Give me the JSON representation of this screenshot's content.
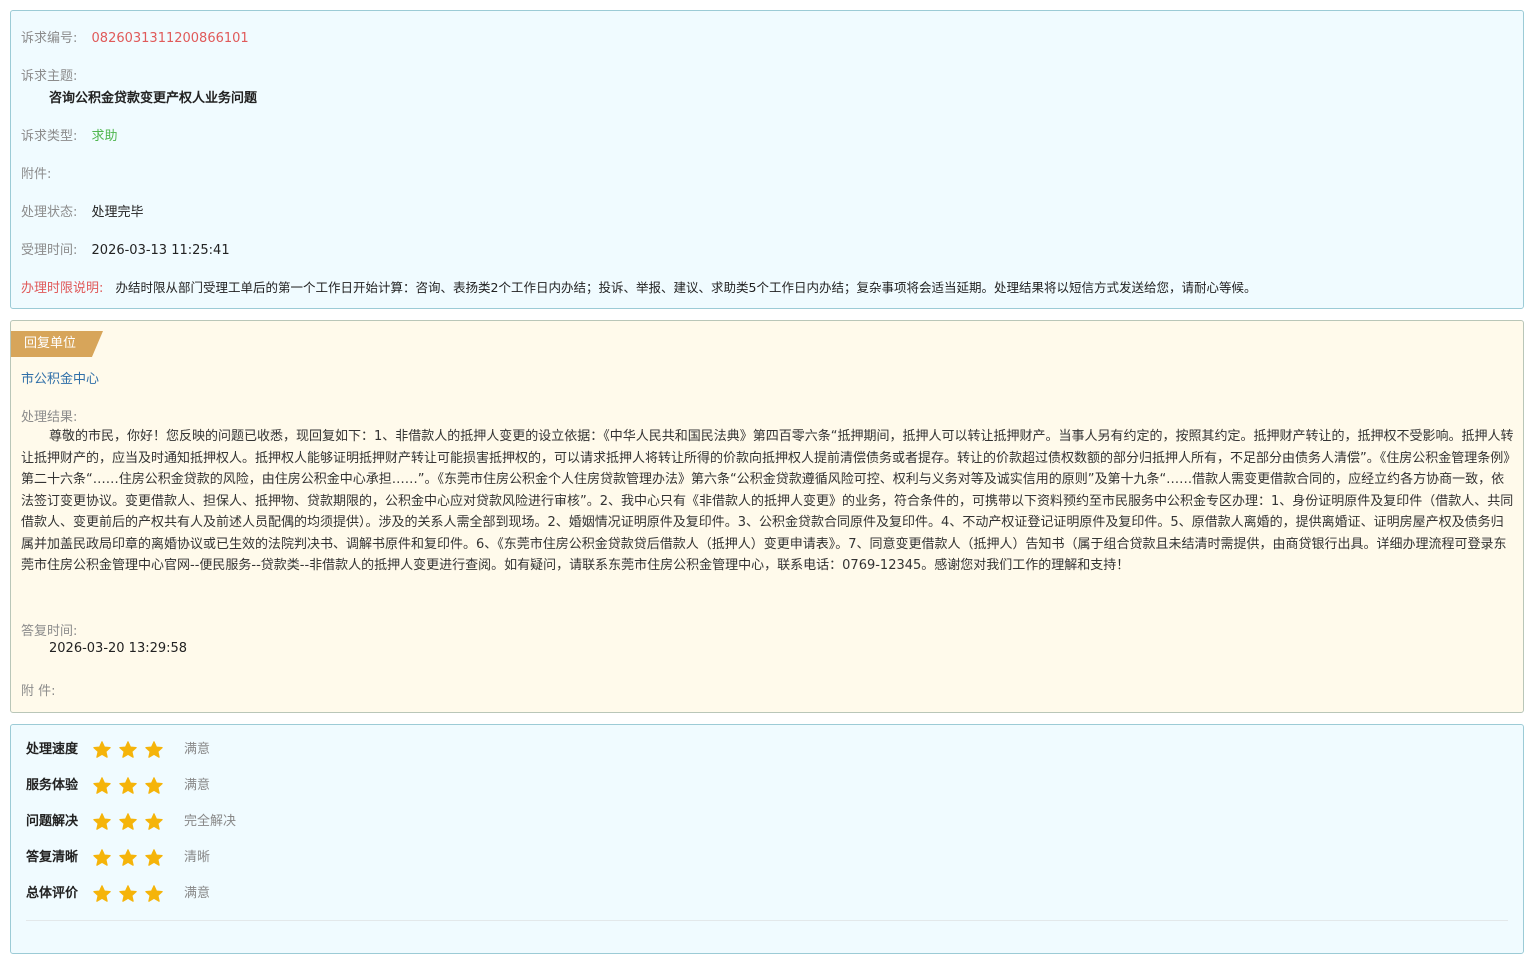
{
  "case": {
    "id_label": "诉求编号:",
    "id_value": "0826031311200866101",
    "subject_label": "诉求主题:",
    "subject_value": "咨询公积金贷款变更产权人业务问题",
    "type_label": "诉求类型:",
    "type_value": "求助",
    "attachment_label": "附件:",
    "status_label": "处理状态:",
    "status_value": "处理完毕",
    "time_label": "受理时间:",
    "time_value": "2026-03-13 11:25:41",
    "deadline_label": "办理时限说明:",
    "deadline_value": "办结时限从部门受理工单后的第一个工作日开始计算：咨询、表扬类2个工作日内办结；投诉、举报、建议、求助类5个工作日内办结；复杂事项将会适当延期。处理结果将以短信方式发送给您，请耐心等候。"
  },
  "reply": {
    "tag": "回复单位",
    "unit": "市公积金中心",
    "result_label": "处理结果:",
    "result_text": "尊敬的市民，你好！您反映的问题已收悉，现回复如下：1、非借款人的抵押人变更的设立依据：《中华人民共和国民法典》第四百零六条“抵押期间，抵押人可以转让抵押财产。当事人另有约定的，按照其约定。抵押财产转让的，抵押权不受影响。抵押人转让抵押财产的，应当及时通知抵押权人。抵押权人能够证明抵押财产转让可能损害抵押权的，可以请求抵押人将转让所得的价款向抵押权人提前清偿债务或者提存。转让的价款超过债权数额的部分归抵押人所有，不足部分由债务人清偿”。《住房公积金管理条例》第二十六条“……住房公积金贷款的风险，由住房公积金中心承担……”。《东莞市住房公积金个人住房贷款管理办法》第六条“公积金贷款遵循风险可控、权利与义务对等及诚实信用的原则”及第十九条“……借款人需变更借款合同的，应经立约各方协商一致，依法签订变更协议。变更借款人、担保人、抵押物、贷款期限的，公积金中心应对贷款风险进行审核”。2、我中心只有《非借款人的抵押人变更》的业务，符合条件的，可携带以下资料预约至市民服务中公积金专区办理：1、身份证明原件及复印件（借款人、共同借款人、变更前后的产权共有人及前述人员配偶的均须提供）。涉及的关系人需全部到现场。2、婚姻情况证明原件及复印件。3、公积金贷款合同原件及复印件。4、不动产权证登记证明原件及复印件。5、原借款人离婚的，提供离婚证、证明房屋产权及债务归属并加盖民政局印章的离婚协议或已生效的法院判决书、调解书原件和复印件。6、《东莞市住房公积金贷款贷后借款人（抵押人）变更申请表》。7、同意变更借款人（抵押人）告知书（属于组合贷款且未结清时需提供，由商贷银行出具。详细办理流程可登录东莞市住房公积金管理中心官网--便民服务--贷款类--非借款人的抵押人变更进行查阅。如有疑问，请联系东莞市住房公积金管理中心，联系电话：0769-12345。感谢您对我们工作的理解和支持！",
    "reply_time_label": "答复时间:",
    "reply_time_value": "2026-03-20 13:29:58",
    "attachment_label": "附 件:"
  },
  "ratings": [
    {
      "label": "处理速度",
      "stars": 3,
      "value": "满意"
    },
    {
      "label": "服务体验",
      "stars": 3,
      "value": "满意"
    },
    {
      "label": "问题解决",
      "stars": 3,
      "value": "完全解决"
    },
    {
      "label": "答复清晰",
      "stars": 3,
      "value": "清晰"
    },
    {
      "label": "总体评价",
      "stars": 3,
      "value": "满意"
    }
  ],
  "colors": {
    "star": "#f5b40a",
    "accent_red": "#e05a5a",
    "accent_green": "#4fb64f"
  }
}
